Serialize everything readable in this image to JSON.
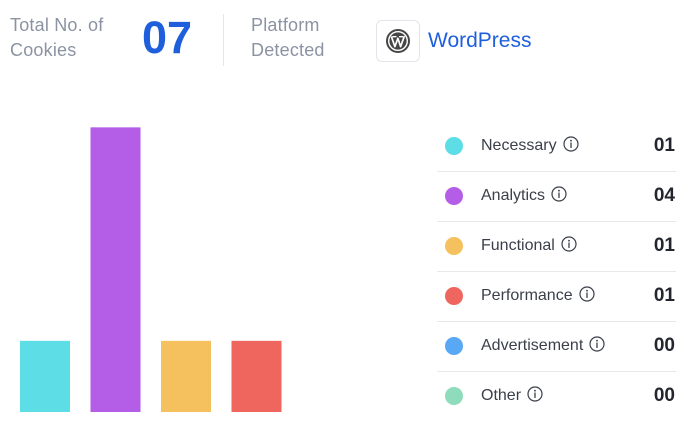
{
  "header": {
    "total_label": "Total No. of Cookies",
    "total_value": "07",
    "platform_label": "Platform Detected",
    "platform_name": "WordPress",
    "platform_icon": "wordpress-logo-icon",
    "accent_color": "#1f5fdc"
  },
  "categories": [
    {
      "label": "Necessary",
      "count": "01",
      "color": "#5ddde6",
      "icon": "info-icon"
    },
    {
      "label": "Analytics",
      "count": "04",
      "color": "#b45ee8",
      "icon": "info-icon"
    },
    {
      "label": "Functional",
      "count": "01",
      "color": "#f4c15e",
      "icon": "info-icon"
    },
    {
      "label": "Performance",
      "count": "01",
      "color": "#ee665e",
      "icon": "info-icon"
    },
    {
      "label": "Advertisement",
      "count": "00",
      "color": "#58a8f5",
      "icon": "info-icon"
    },
    {
      "label": "Other",
      "count": "00",
      "color": "#8fdcbd",
      "icon": "info-icon"
    }
  ],
  "chart_data": {
    "type": "bar",
    "categories": [
      "Necessary",
      "Analytics",
      "Functional",
      "Performance",
      "Advertisement",
      "Other"
    ],
    "values": [
      1,
      4,
      1,
      1,
      0,
      0
    ],
    "colors": [
      "#5ddde6",
      "#b45ee8",
      "#f4c15e",
      "#ee665e",
      "#58a8f5",
      "#8fdcbd"
    ],
    "ylim": [
      0,
      4.3
    ],
    "grid": false,
    "axes_visible": false
  }
}
